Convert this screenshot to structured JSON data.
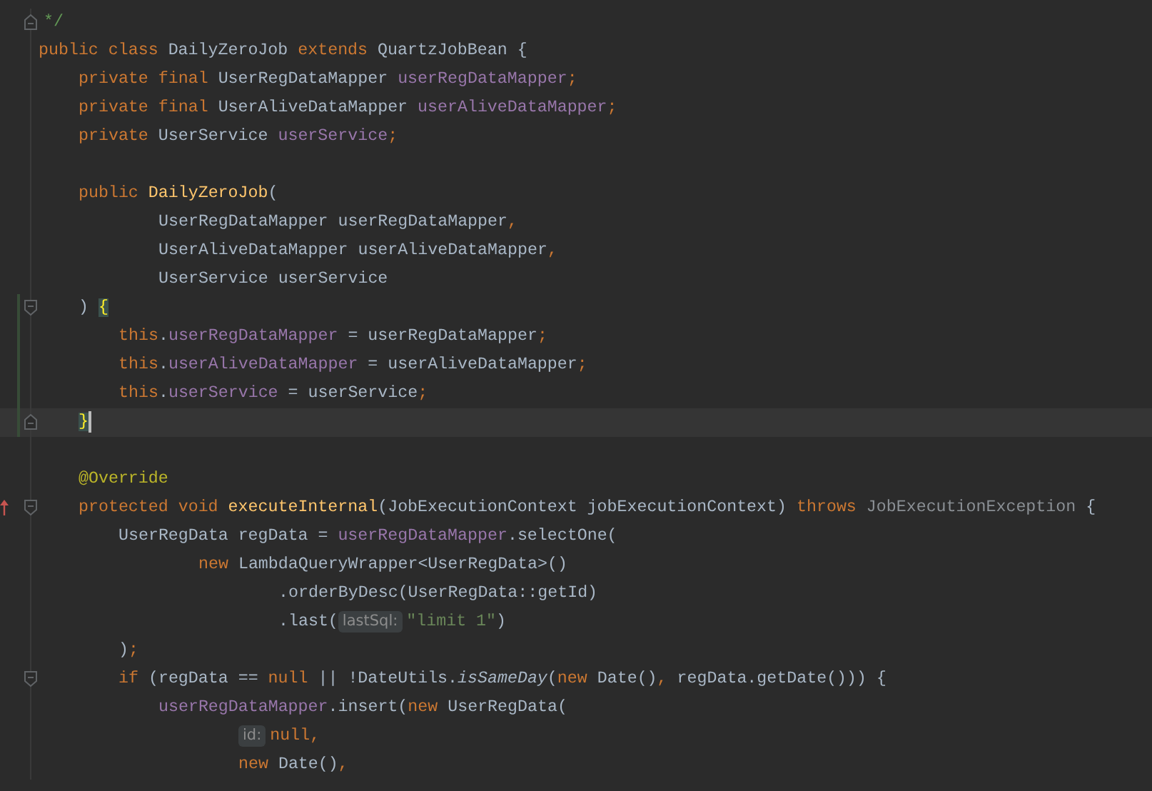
{
  "editor": {
    "lines": [
      {
        "kind": "block",
        "gutter_icon": {
          "kind": "fold-end"
        },
        "changed": false,
        "current": false,
        "tokens": [
          {
            "text": "*/",
            "kind": "comment"
          }
        ]
      },
      {
        "kind": "block",
        "changed": false,
        "current": false,
        "tokens": [
          {
            "text": "public class ",
            "kind": "kw"
          },
          {
            "text": "DailyZeroJob ",
            "kind": "plain"
          },
          {
            "text": "extends ",
            "kind": "kw"
          },
          {
            "text": "QuartzJobBean {",
            "kind": "plain"
          }
        ],
        "children": [
          {
            "kind": "block",
            "changed": false,
            "current": false,
            "tokens": [
              {
                "text": "private final ",
                "kind": "kw"
              },
              {
                "text": "UserRegDataMapper ",
                "kind": "plain"
              },
              {
                "text": "userRegDataMapper",
                "kind": "field"
              },
              {
                "text": ";",
                "kind": "kw"
              }
            ]
          },
          {
            "kind": "block",
            "changed": false,
            "current": false,
            "tokens": [
              {
                "text": "private final ",
                "kind": "kw"
              },
              {
                "text": "UserAliveDataMapper ",
                "kind": "plain"
              },
              {
                "text": "userAliveDataMapper",
                "kind": "field"
              },
              {
                "text": ";",
                "kind": "kw"
              }
            ]
          },
          {
            "kind": "block",
            "changed": false,
            "current": false,
            "tokens": [
              {
                "text": "private ",
                "kind": "kw"
              },
              {
                "text": "UserService ",
                "kind": "plain"
              },
              {
                "text": "userService",
                "kind": "field"
              },
              {
                "text": ";",
                "kind": "kw"
              }
            ]
          },
          {
            "kind": "block",
            "changed": false,
            "current": false
          },
          {
            "kind": "block",
            "changed": false,
            "current": false,
            "tokens": [
              {
                "text": "public ",
                "kind": "kw"
              },
              {
                "text": "DailyZeroJob",
                "kind": "decl"
              },
              {
                "text": "(",
                "kind": "plain"
              }
            ],
            "children": [
              {
                "kind": "continuation",
                "changed": false,
                "current": false,
                "tokens": [
                  {
                    "text": "UserRegDataMapper userRegDataMapper",
                    "kind": "plain"
                  },
                  {
                    "text": ",",
                    "kind": "kw"
                  }
                ]
              },
              {
                "kind": "continuation",
                "changed": false,
                "current": false,
                "tokens": [
                  {
                    "text": "UserAliveDataMapper userAliveDataMapper",
                    "kind": "plain"
                  },
                  {
                    "text": ",",
                    "kind": "kw"
                  }
                ]
              },
              {
                "kind": "continuation",
                "changed": false,
                "current": false,
                "tokens": [
                  {
                    "text": "UserService userService",
                    "kind": "plain"
                  }
                ]
              }
            ]
          },
          {
            "kind": "block",
            "gutter_icon": {
              "kind": "fold-start"
            },
            "changed": true,
            "current": false,
            "tokens": [
              {
                "text": ") ",
                "kind": "plain"
              },
              {
                "text": "{",
                "kind": "brace"
              }
            ],
            "children": [
              {
                "kind": "block",
                "changed": true,
                "current": false,
                "tokens": [
                  {
                    "text": "this",
                    "kind": "kw"
                  },
                  {
                    "text": ".",
                    "kind": "plain"
                  },
                  {
                    "text": "userRegDataMapper",
                    "kind": "field"
                  },
                  {
                    "text": " = userRegDataMapper",
                    "kind": "plain"
                  },
                  {
                    "text": ";",
                    "kind": "kw"
                  }
                ]
              },
              {
                "kind": "block",
                "changed": true,
                "current": false,
                "tokens": [
                  {
                    "text": "this",
                    "kind": "kw"
                  },
                  {
                    "text": ".",
                    "kind": "plain"
                  },
                  {
                    "text": "userAliveDataMapper",
                    "kind": "field"
                  },
                  {
                    "text": " = userAliveDataMapper",
                    "kind": "plain"
                  },
                  {
                    "text": ";",
                    "kind": "kw"
                  }
                ]
              },
              {
                "kind": "block",
                "changed": true,
                "current": false,
                "tokens": [
                  {
                    "text": "this",
                    "kind": "kw"
                  },
                  {
                    "text": ".",
                    "kind": "plain"
                  },
                  {
                    "text": "userService",
                    "kind": "field"
                  },
                  {
                    "text": " = userService",
                    "kind": "plain"
                  },
                  {
                    "text": ";",
                    "kind": "kw"
                  }
                ]
              }
            ]
          },
          {
            "kind": "block",
            "gutter_icon": {
              "kind": "fold-end"
            },
            "changed": true,
            "current": true,
            "tokens": [
              {
                "text": "}",
                "kind": "brace"
              }
            ]
          },
          {
            "kind": "block",
            "changed": false,
            "current": false
          },
          {
            "kind": "block",
            "changed": false,
            "current": false,
            "tokens": [
              {
                "text": "@Override",
                "kind": "ann"
              }
            ]
          },
          {
            "kind": "block",
            "gutter_icon": {
              "kind": "override"
            },
            "changed": false,
            "current": false,
            "tokens": [
              {
                "text": "protected void ",
                "kind": "kw"
              },
              {
                "text": "executeInternal",
                "kind": "decl"
              },
              {
                "text": "(JobExecutionContext jobExecutionContext) ",
                "kind": "plain"
              },
              {
                "text": "throws ",
                "kind": "kw"
              },
              {
                "text": "JobExecutionException ",
                "kind": "muted"
              },
              {
                "text": "{",
                "kind": "plain"
              }
            ],
            "children": [
              {
                "kind": "block",
                "changed": false,
                "current": false,
                "tokens": [
                  {
                    "text": "UserRegData regData = ",
                    "kind": "plain"
                  },
                  {
                    "text": "userRegDataMapper",
                    "kind": "field"
                  },
                  {
                    "text": ".selectOne(",
                    "kind": "plain"
                  }
                ],
                "children": [
                  {
                    "kind": "continuation",
                    "changed": false,
                    "current": false,
                    "tokens": [
                      {
                        "text": "new ",
                        "kind": "kw"
                      },
                      {
                        "text": "LambdaQueryWrapper<UserRegData>()",
                        "kind": "plain"
                      }
                    ],
                    "children": [
                      {
                        "kind": "continuation",
                        "changed": false,
                        "current": false,
                        "tokens": [
                          {
                            "text": ".orderByDesc(UserRegData::getId)",
                            "kind": "plain"
                          }
                        ]
                      },
                      {
                        "kind": "continuation",
                        "changed": false,
                        "current": false,
                        "tokens": [
                          {
                            "text": ".last(",
                            "kind": "plain"
                          },
                          {
                            "text": "lastSql:",
                            "kind": "hint"
                          },
                          {
                            "text": "\"limit 1\"",
                            "kind": "str"
                          },
                          {
                            "text": ")",
                            "kind": "plain"
                          }
                        ]
                      }
                    ]
                  }
                ]
              },
              {
                "kind": "block",
                "changed": false,
                "current": false,
                "tokens": [
                  {
                    "text": ")",
                    "kind": "plain"
                  },
                  {
                    "text": ";",
                    "kind": "kw"
                  }
                ]
              },
              {
                "kind": "block",
                "gutter_icon": {
                  "kind": "fold-start"
                },
                "changed": false,
                "current": false,
                "tokens": [
                  {
                    "text": "if ",
                    "kind": "kw"
                  },
                  {
                    "text": "(regData == ",
                    "kind": "plain"
                  },
                  {
                    "text": "null ",
                    "kind": "kw"
                  },
                  {
                    "text": "|| !DateUtils.",
                    "kind": "plain"
                  },
                  {
                    "text": "isSameDay",
                    "kind": "static"
                  },
                  {
                    "text": "(",
                    "kind": "plain"
                  },
                  {
                    "text": "new ",
                    "kind": "kw"
                  },
                  {
                    "text": "Date()",
                    "kind": "plain"
                  },
                  {
                    "text": ", ",
                    "kind": "kw"
                  },
                  {
                    "text": "regData.getDate())) {",
                    "kind": "plain"
                  }
                ],
                "children": [
                  {
                    "kind": "block",
                    "changed": false,
                    "current": false,
                    "tokens": [
                      {
                        "text": "userRegDataMapper",
                        "kind": "field"
                      },
                      {
                        "text": ".insert(",
                        "kind": "plain"
                      },
                      {
                        "text": "new ",
                        "kind": "kw"
                      },
                      {
                        "text": "UserRegData(",
                        "kind": "plain"
                      }
                    ],
                    "children": [
                      {
                        "kind": "continuation",
                        "changed": false,
                        "current": false,
                        "tokens": [
                          {
                            "text": "id:",
                            "kind": "hint"
                          },
                          {
                            "text": "null,",
                            "kind": "kw"
                          }
                        ]
                      },
                      {
                        "kind": "continuation",
                        "changed": false,
                        "current": false,
                        "tokens": [
                          {
                            "text": "new ",
                            "kind": "kw"
                          },
                          {
                            "text": "Date()",
                            "kind": "plain"
                          },
                          {
                            "text": ",",
                            "kind": "kw"
                          }
                        ]
                      }
                    ]
                  }
                ]
              }
            ]
          }
        ]
      }
    ]
  }
}
